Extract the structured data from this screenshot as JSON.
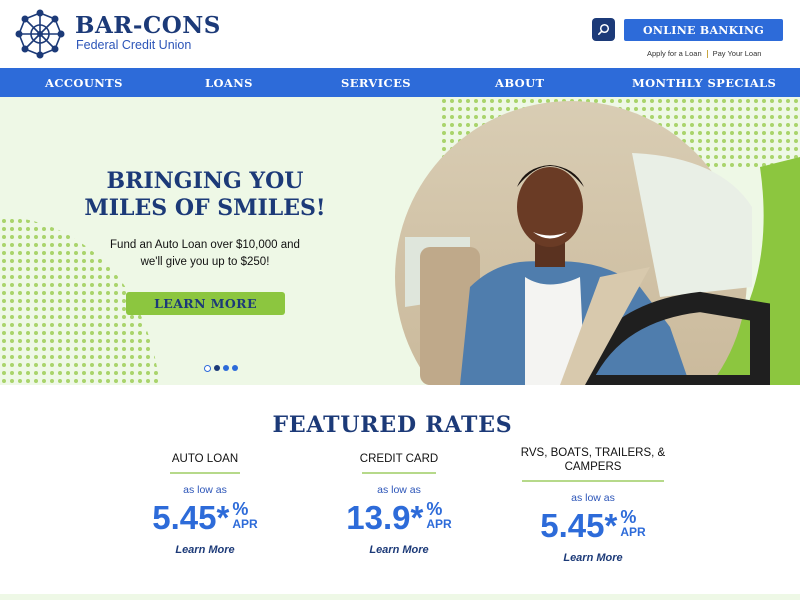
{
  "brand": {
    "name": "BAR-CONS",
    "subtitle": "Federal Credit Union",
    "colors": {
      "navy": "#1c3a78",
      "blue": "#2d6bd9",
      "green": "#8cc63f",
      "hero_bg": "#eef8e6"
    }
  },
  "header": {
    "search_icon": "search-icon",
    "online_banking": "ONLINE BANKING",
    "apply_loan": "Apply for a Loan",
    "pay_loan": "Pay Your Loan"
  },
  "nav": {
    "items": [
      {
        "label": "ACCOUNTS"
      },
      {
        "label": "LOANS"
      },
      {
        "label": "SERVICES"
      },
      {
        "label": "ABOUT"
      },
      {
        "label": "MONTHLY SPECIALS"
      }
    ]
  },
  "hero": {
    "title_line1": "BRINGING YOU",
    "title_line2": "MILES OF SMILES!",
    "text_line1": "Fund an Auto Loan over $10,000 and",
    "text_line2": "we'll give you up to $250!",
    "button": "LEARN MORE",
    "slide_count": 4,
    "active_slide": 2
  },
  "featured": {
    "title": "FEATURED RATES",
    "rates": [
      {
        "name_line1": "AUTO LOAN",
        "name_line2": "",
        "low": "as low as",
        "value": "5.45*",
        "pct": "%",
        "apr": "APR",
        "more": "Learn More"
      },
      {
        "name_line1": "CREDIT CARD",
        "name_line2": "",
        "low": "as low as",
        "value": "13.9*",
        "pct": "%",
        "apr": "APR",
        "more": "Learn More"
      },
      {
        "name_line1": "RVS, BOATS, TRAILERS, &",
        "name_line2": "CAMPERS",
        "low": "as low as",
        "value": "5.45*",
        "pct": "%",
        "apr": "APR",
        "more": "Learn More"
      }
    ]
  }
}
